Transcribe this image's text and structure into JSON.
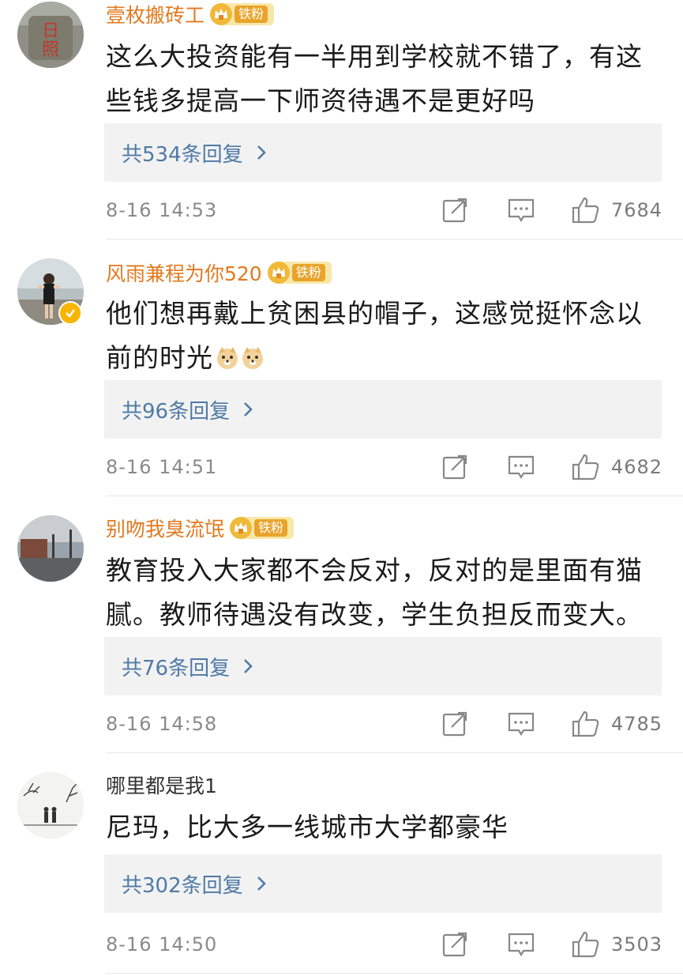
{
  "comments": [
    {
      "username": "壹枚搬砖工",
      "fan_badge": "铁粉",
      "text": "这么大投资能有一半用到学校就不错了，有这些钱多提高一下师资待遇不是更好吗",
      "replies_label": "共534条回复",
      "timestamp": "8-16 14:53",
      "likes": "7684"
    },
    {
      "username": "风雨兼程为你520",
      "fan_badge": "铁粉",
      "text": "他们想再戴上贫困县的帽子，这感觉挺怀念以前的时光",
      "replies_label": "共96条回复",
      "timestamp": "8-16 14:51",
      "likes": "4682"
    },
    {
      "username": "别吻我臭流氓",
      "fan_badge": "铁粉",
      "text": "教育投入大家都不会反对，反对的是里面有猫腻。教师待遇没有改变，学生负担反而变大。",
      "replies_label": "共76条回复",
      "timestamp": "8-16 14:58",
      "likes": "4785"
    },
    {
      "username": "哪里都是我1",
      "text": "尼玛，比大多一线城市大学都豪华",
      "replies_label": "共302条回复",
      "timestamp": "8-16 14:50",
      "likes": "3503"
    }
  ],
  "colors": {
    "username": "#e2791e",
    "reply_link": "#4f7aa6",
    "reply_box_bg": "#f2f2f2",
    "meta_text": "#8a8a8a",
    "badge_bg": "#f8e7a8",
    "verified": "#f7b500"
  },
  "icons": [
    "share-icon",
    "reply-icon",
    "like-icon",
    "chevron-right-icon",
    "crown-icon",
    "verified-icon",
    "doge-emoji"
  ]
}
